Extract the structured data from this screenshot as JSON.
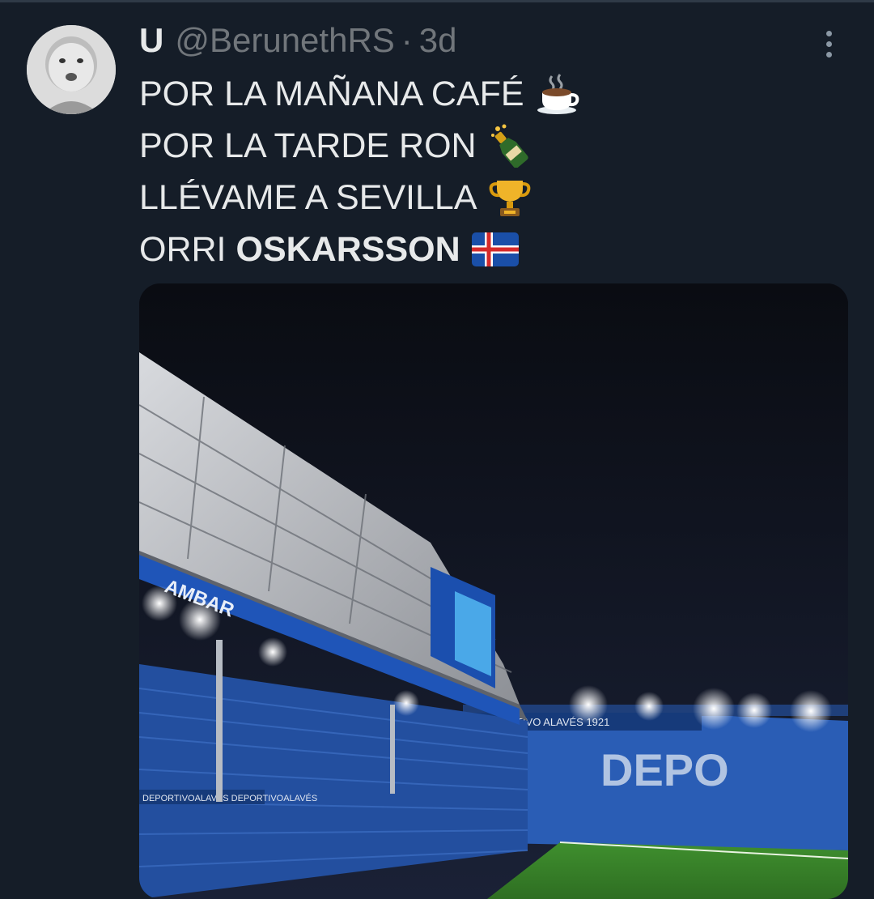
{
  "tweet": {
    "author_name": "U",
    "handle": "@BerunethRS",
    "separator": "·",
    "time": "3d",
    "lines": [
      {
        "text": "POR LA MAÑANA CAFÉ",
        "emoji": "hot-beverage-icon"
      },
      {
        "text": "POR LA TARDE RON",
        "emoji": "bottle-icon"
      },
      {
        "text": "LLÉVAME A SEVILLA",
        "emoji": "trophy-icon"
      },
      {
        "prefix": "ORRI",
        "bold": "OSKARSSON",
        "emoji": "iceland-flag-icon"
      }
    ]
  },
  "media": {
    "subject": "stadium-photo",
    "banner_brand": "AMBAR",
    "club_banner": "DEPORTIVO ALAVÉS 1921",
    "seat_letters": "DEPO",
    "lower_banner": "DEPORTIVOALAVÉS DEPORTIVOALAVÉS"
  },
  "colors": {
    "background": "#151d28",
    "text": "#e7e9ea",
    "muted": "#71767b",
    "stand_blue": "#2a5db5"
  }
}
